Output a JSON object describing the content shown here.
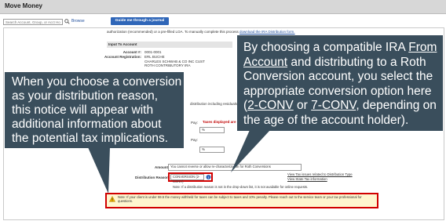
{
  "window": {
    "title": "Move Money"
  },
  "toolbar": {
    "search_placeholder": "Search Account, Group, or Acct Holder",
    "browse_label": "Browse",
    "guide_button_label": "Guide me through a journal transaction"
  },
  "top_text": {
    "line": "authorization (recommended) or a pre-filled LOA. To manually complete this process",
    "link": "download the IRA Distribution form."
  },
  "input_section": {
    "header": "Input To Account",
    "account_label": "Account #:",
    "account_value": "0001-0001",
    "registration_label": "Account Registration:",
    "registration_lines": [
      "ERL BUCHE",
      "CHARLES SCHWAB & CO INC CUST",
      "ROTH CONTRIBUTORY IRA"
    ]
  },
  "form": {
    "distribution_including_residuals": "distribution including residuals",
    "pay_label_1": "Pay:",
    "taxes_note": "Taxes displayed are b",
    "pay_label_2": "Pay:",
    "pct_symbol": "%",
    "amount_label": "Amount",
    "amount_note": "You cannot reverse or allow re-characterization for Roth Conversions",
    "distribution_reason_label": "Distribution Reason:",
    "distribution_reason_value": "CONVERSION (2-CONV)",
    "link_tax_issues": "View Tax issues related to Distribution Type",
    "link_state_tax": "View State Tax information",
    "reason_note": "Note: If a distribution reason is not in the drop-down list, it is not available for online requests."
  },
  "warning": {
    "text": "Note: If your client is under 59.5 the money withheld for taxes can be subject to taxes and 10% penalty. Please reach out to the service team or your tax professional for questions."
  },
  "callout_left": {
    "lines": [
      "When you choose a conversion",
      "as your distribution reason,",
      "this notice will appear with",
      "additional information about",
      "the potential tax implications."
    ]
  },
  "callout_right": {
    "line1_pre": "By choosing a compatible IRA ",
    "line1_link": "From",
    "line2_link": "Account",
    "line2_post": " and distributing to a Roth",
    "line3": "Conversion account, you select the",
    "line4": "appropriate conversion option here",
    "line5_pre": "(",
    "line5_link1": "2-CONV",
    "line5_mid": " or ",
    "line5_link2": "7-CONV",
    "line5_post": ", depending on",
    "line6": "the age of the account holder)."
  },
  "colors": {
    "callout_bg": "#3a4e5c",
    "highlight_red": "#d10000",
    "guide_blue": "#2f66b8"
  }
}
